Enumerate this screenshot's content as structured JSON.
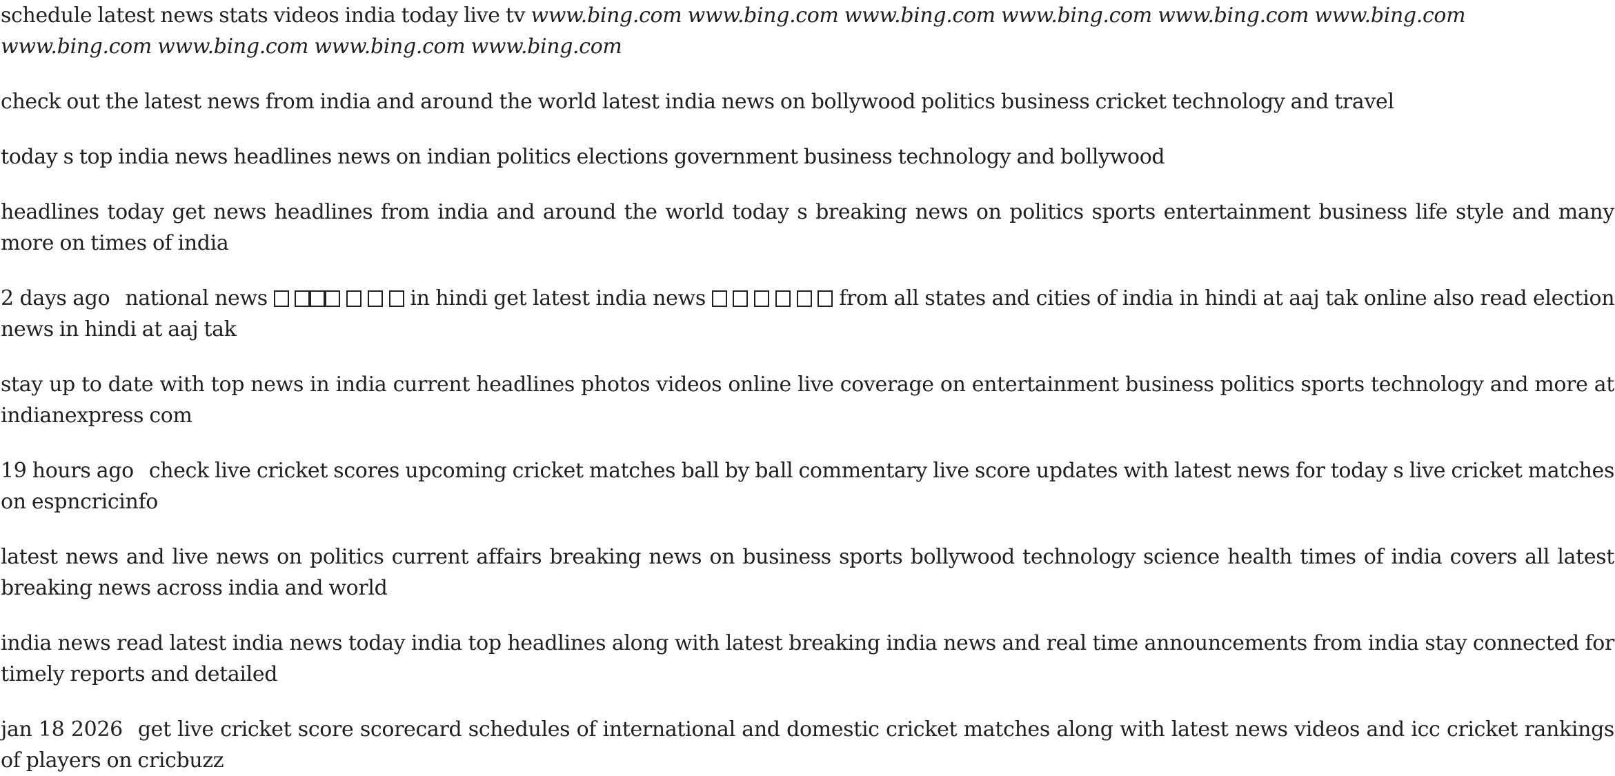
{
  "header": {
    "text": "schedule latest news stats videos india today live tv",
    "urls": [
      "www.bing.com",
      "www.bing.com",
      "www.bing.com",
      "www.bing.com",
      "www.bing.com",
      "www.bing.com",
      "www.bing.com",
      "www.bing.com",
      "www.bing.com",
      "www.bing.com"
    ]
  },
  "snippets": [
    {
      "text": "check out the latest news from india and around the world latest india news on bollywood politics business cricket technology and travel"
    },
    {
      "text": "today s top india news headlines news on indian politics elections government business technology and bollywood"
    },
    {
      "text": "headlines today get news headlines from india and around the world today s breaking news on politics sports entertainment business life style and many more on times of india"
    },
    {
      "time": "2 days ago",
      "part1": "national news",
      "part2": "in hindi get latest india news",
      "part3": "from all states and cities of india in hindi at aaj tak online also read election news in hindi at aaj tak"
    },
    {
      "text": "stay up to date with top news in india current headlines photos videos online live coverage on entertainment business politics sports technology and more at indianexpress com"
    },
    {
      "time": "19 hours ago",
      "text": "check live cricket scores upcoming cricket matches ball by ball commentary live score updates with latest news for today s live cricket matches on espncricinfo"
    },
    {
      "text": "latest news and live news on politics current affairs breaking news on business sports bollywood technology science health times of india covers all latest breaking news across india and world"
    },
    {
      "text": "india news read latest india news today india top headlines along with latest breaking india news and real time announcements from india stay connected for timely reports and detailed"
    },
    {
      "time": "jan 18 2026",
      "text": "get live cricket score scorecard schedules of international and domestic cricket matches along with latest news videos and icc cricket rankings of players on cricbuzz"
    }
  ]
}
